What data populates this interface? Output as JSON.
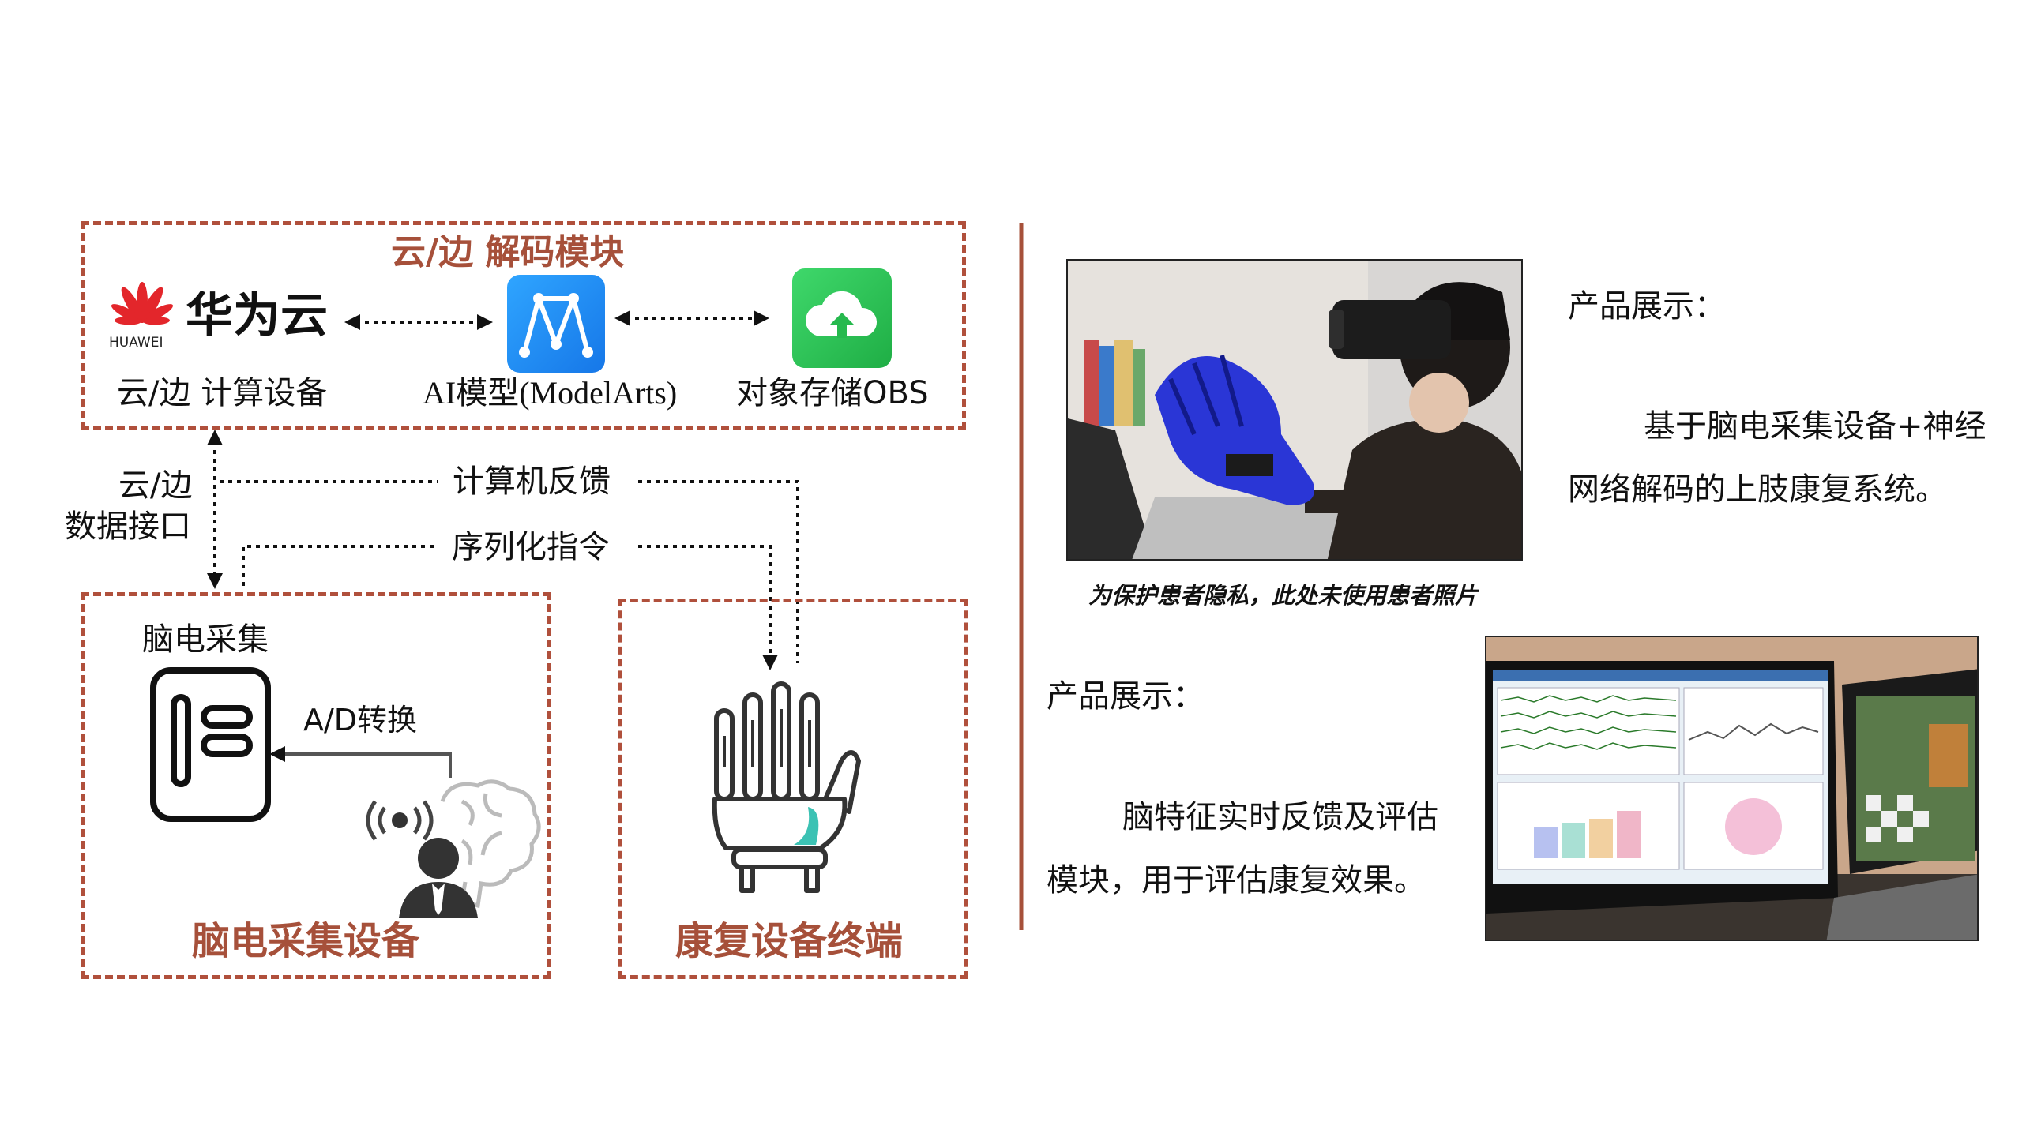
{
  "cloud_module": {
    "title": "云/边 解码模块",
    "huawei_brand": "华为云",
    "huawei_sub": "HUAWEI",
    "compute_label": "云/边 计算设备",
    "ai_label": "AI模型(ModelArts)",
    "obs_label": "对象存储OBS"
  },
  "links": {
    "data_interface": [
      "云/边",
      "数据接口"
    ],
    "feedback": "计算机反馈",
    "serial_command": "序列化指令",
    "ad_convert": "A/D转换"
  },
  "eeg_module": {
    "top_label": "脑电采集",
    "title": "脑电采集设备"
  },
  "rehab_module": {
    "title": "康复设备终端"
  },
  "showcase_1": {
    "heading": "产品展示：",
    "description": "基于脑电采集设备+神经网络解码的上肢康复系统。",
    "caption": "为保护患者隐私，此处未使用患者照片"
  },
  "showcase_2": {
    "heading": "产品展示：",
    "description": "脑特征实时反馈及评估模块，用于评估康复效果。"
  },
  "colors": {
    "accent": "#a6503a",
    "dashed_border": "#b0503c",
    "huawei_red": "#e3262b",
    "modelarts_blue": "#1e8cf0",
    "obs_green": "#2cc55a",
    "glove_blue": "#2a36d6",
    "teal": "#3cc2b4"
  },
  "icons": [
    "huawei-logo-icon",
    "modelarts-icon",
    "obs-cloud-upload-icon",
    "eeg-device-icon",
    "person-brain-icon",
    "robotic-hand-icon"
  ]
}
